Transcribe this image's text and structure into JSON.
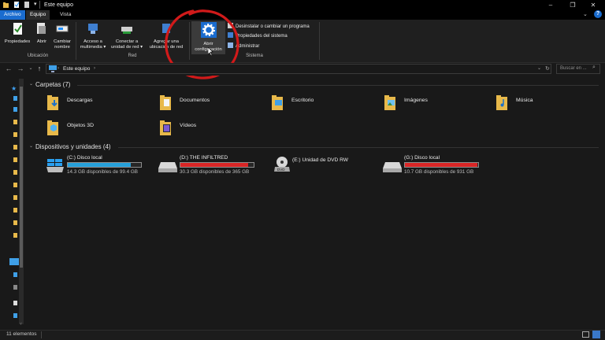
{
  "window": {
    "title": "Este equipo",
    "minimize": "–",
    "maximize": "❐",
    "close": "✕"
  },
  "tabs": [
    {
      "label": "Archivo",
      "active": true
    },
    {
      "label": "Equipo",
      "active": false
    },
    {
      "label": "Vista",
      "active": false
    }
  ],
  "ribbon": {
    "ubicacion": {
      "group_label": "Ubicación",
      "buttons": [
        {
          "label": "Propiedades"
        },
        {
          "label": "Abrir"
        },
        {
          "label": "Cambiar nombre"
        }
      ]
    },
    "red": {
      "group_label": "Red",
      "buttons": [
        {
          "label": "Acceso a multimedia ▾"
        },
        {
          "label": "Conectar a unidad de red ▾"
        },
        {
          "label": "Agregar una ubicación de red"
        }
      ]
    },
    "sistema": {
      "group_label": "Sistema",
      "big_button": "Abrir configuración",
      "items": [
        {
          "label": "Desinstalar o cambiar un programa"
        },
        {
          "label": "Propiedades del sistema"
        },
        {
          "label": "Administrar"
        }
      ]
    }
  },
  "address": {
    "path": "Este equipo",
    "separator": "›",
    "search_placeholder": "Buscar en ..."
  },
  "folders_section": {
    "title": "Carpetas (7)",
    "items": [
      {
        "label": "Descargas",
        "icon": "downloads-folder-icon"
      },
      {
        "label": "Documentos",
        "icon": "documents-folder-icon"
      },
      {
        "label": "Escritorio",
        "icon": "desktop-folder-icon"
      },
      {
        "label": "Imágenes",
        "icon": "pictures-folder-icon"
      },
      {
        "label": "Música",
        "icon": "music-folder-icon"
      },
      {
        "label": "Objetos 3D",
        "icon": "3d-objects-folder-icon"
      },
      {
        "label": "Vídeos",
        "icon": "videos-folder-icon"
      }
    ]
  },
  "drives_section": {
    "title": "Dispositivos y unidades (4)",
    "items": [
      {
        "name": "(C:) Disco local",
        "free": "14.3 GB disponibles de 99.4 GB",
        "used_fraction": 0.86,
        "bar_color": "#26a0da",
        "icon": "windows-drive-icon"
      },
      {
        "name": "(D:) THE INFILTRED",
        "free": "30.3 GB disponibles de 365 GB",
        "used_fraction": 0.92,
        "bar_color": "#da2626",
        "icon": "hard-drive-icon"
      },
      {
        "name": "(E:) Unidad de DVD RW",
        "free": "",
        "used_fraction": null,
        "bar_color": "",
        "icon": "dvd-drive-icon"
      },
      {
        "name": "(G:) Disco local",
        "free": "10.7 GB disponibles de 931 GB",
        "used_fraction": 0.99,
        "bar_color": "#da2626",
        "icon": "hard-drive-icon"
      }
    ]
  },
  "status": {
    "text": "11 elementos"
  },
  "colors": {
    "annotation_red": "#d11a1a",
    "folder_yellow": "#e8b94a",
    "accent_blue": "#1e90ff"
  }
}
